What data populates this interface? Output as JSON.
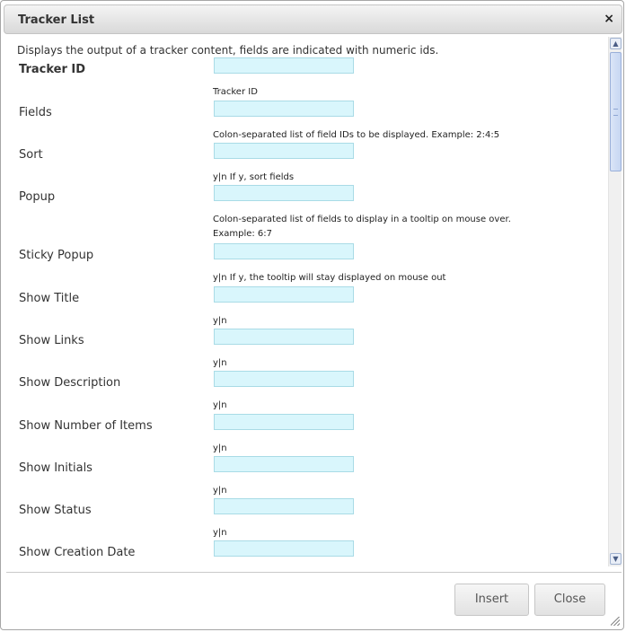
{
  "dialog": {
    "title": "Tracker List",
    "close_glyph": "×",
    "description": "Displays the output of a tracker content, fields are indicated with numeric ids."
  },
  "fields": [
    {
      "label": "Tracker ID",
      "bold": true,
      "value": "",
      "hint": "Tracker ID"
    },
    {
      "label": "Fields",
      "value": "",
      "hint": "Colon-separated list of field IDs to be displayed. Example: 2:4:5"
    },
    {
      "label": "Sort",
      "value": "",
      "hint": "y|n If y, sort fields"
    },
    {
      "label": "Popup",
      "value": "",
      "hint": "Colon-separated list of fields to display in a tooltip on mouse over.",
      "hint2": "Example: 6:7"
    },
    {
      "label": "Sticky Popup",
      "value": "",
      "hint": "y|n If y, the tooltip will stay displayed on mouse out"
    },
    {
      "label": "Show Title",
      "value": "",
      "hint": "y|n"
    },
    {
      "label": "Show Links",
      "value": "",
      "hint": "y|n"
    },
    {
      "label": "Show Description",
      "value": "",
      "hint": "y|n"
    },
    {
      "label": "Show Number of Items",
      "value": "",
      "hint": "y|n"
    },
    {
      "label": "Show Initials",
      "value": "",
      "hint": "y|n"
    },
    {
      "label": "Show Status",
      "value": "",
      "hint": "y|n"
    },
    {
      "label": "Show Creation Date",
      "value": "",
      "hint": ""
    }
  ],
  "buttons": {
    "insert": "Insert",
    "close": "Close"
  },
  "icons": {
    "close": "close-icon",
    "scroll_up": "chevron-up-icon",
    "scroll_down": "chevron-down-icon",
    "resize": "resize-grip-icon"
  },
  "colors": {
    "input_bg": "#d9f6fc",
    "input_border": "#a9dbe6"
  }
}
